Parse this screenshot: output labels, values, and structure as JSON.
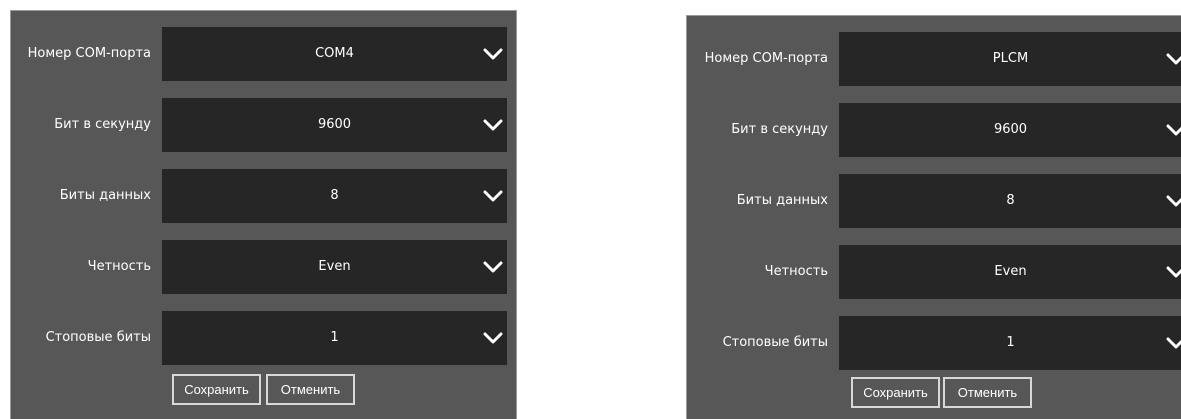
{
  "labels": {
    "port": "Номер COM-порта",
    "baud": "Бит в секунду",
    "data_bits": "Биты данных",
    "parity": "Четность",
    "stop_bits": "Стоповые биты"
  },
  "buttons": {
    "save": "Сохранить",
    "cancel": "Отменить"
  },
  "left": {
    "port": "COM4",
    "baud": "9600",
    "data_bits": "8",
    "parity": "Even",
    "stop_bits": "1"
  },
  "right": {
    "port": "PLCM",
    "baud": "9600",
    "data_bits": "8",
    "parity": "Even",
    "stop_bits": "1"
  },
  "icons": {
    "dropdown": "chevron-down-icon"
  },
  "colors": {
    "panel_bg": "#575757",
    "select_bg": "#262626",
    "text": "#ffffff",
    "button_border": "#d8d8d8"
  }
}
